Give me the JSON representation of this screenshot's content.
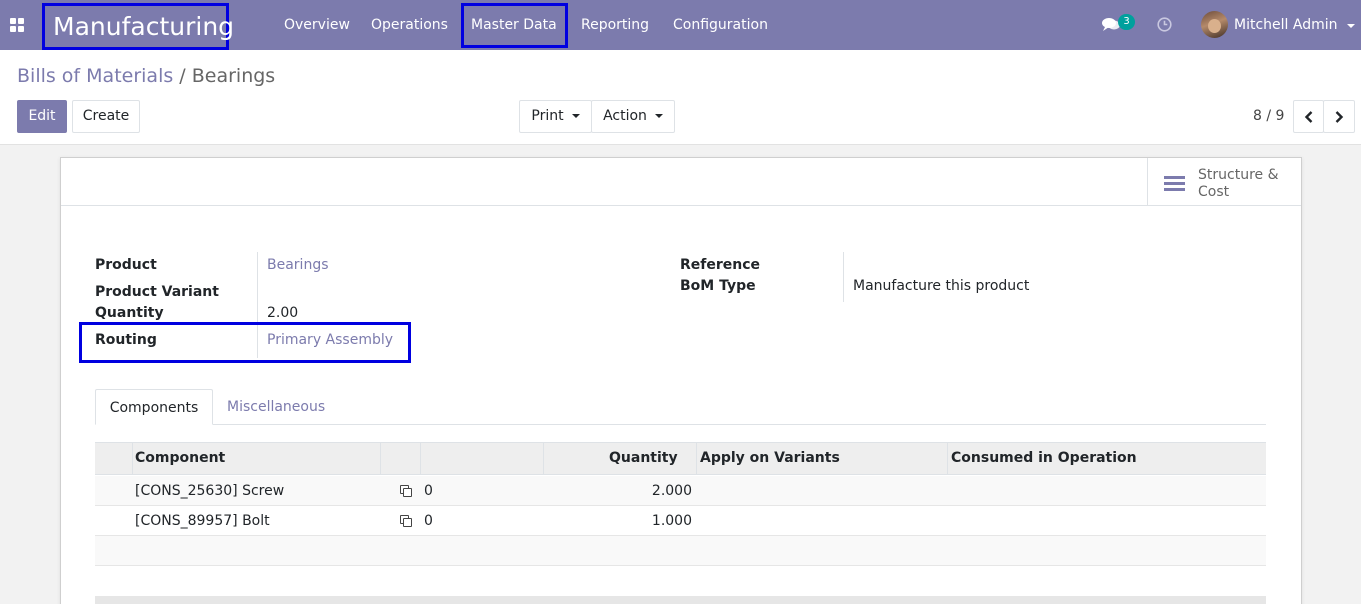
{
  "navbar": {
    "app_name": "Manufacturing",
    "menu": [
      "Overview",
      "Operations",
      "Master Data",
      "Reporting",
      "Configuration"
    ],
    "highlighted_menu": "Master Data",
    "message_count": "3",
    "user_name": "Mitchell Admin",
    "icons": [
      "apps-grid-icon",
      "chat-icon",
      "clock-icon",
      "avatar"
    ],
    "color": "#7c7bad"
  },
  "control_panel": {
    "breadcrumb_parent": "Bills of Materials",
    "breadcrumb_separator": "/",
    "breadcrumb_current": "Bearings",
    "edit_label": "Edit",
    "create_label": "Create",
    "print_label": "Print",
    "action_label": "Action",
    "pager": "8 / 9"
  },
  "smart_button": {
    "label": "Structure & Cost",
    "icon": "bars-icon"
  },
  "form": {
    "product_label": "Product",
    "product_value": "Bearings",
    "variant_label": "Product Variant",
    "variant_value": "",
    "quantity_label": "Quantity",
    "quantity_value": "2.00",
    "routing_label": "Routing",
    "routing_value": "Primary Assembly",
    "reference_label": "Reference",
    "reference_value": "",
    "bom_type_label": "BoM Type",
    "bom_type_value": "Manufacture this product"
  },
  "tabs": [
    "Components",
    "Miscellaneous"
  ],
  "active_tab": "Components",
  "table": {
    "headers": [
      "Component",
      "",
      "Quantity",
      "Apply on Variants",
      "Consumed in Operation"
    ],
    "rows": [
      {
        "component": "[CONS_25630] Screw",
        "copy_count": "0",
        "quantity": "2.000",
        "variants": "",
        "operation": ""
      },
      {
        "component": "[CONS_89957] Bolt",
        "copy_count": "0",
        "quantity": "1.000",
        "variants": "",
        "operation": ""
      }
    ]
  },
  "highlight_color": "#0000e0"
}
